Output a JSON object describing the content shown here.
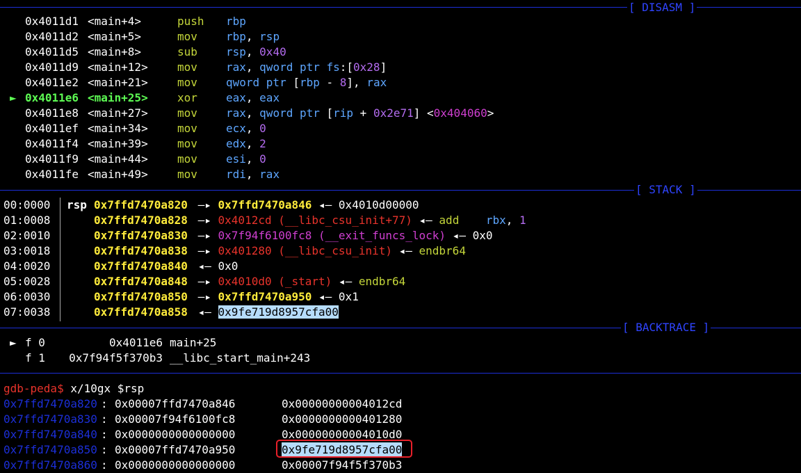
{
  "sections": {
    "disasm": "[ DISASM ]",
    "stack": "[ STACK ]",
    "backtrace": "[ BACKTRACE ]"
  },
  "disasm": [
    {
      "addr": "0x4011d1",
      "sym": "<main+4>",
      "op": "push",
      "args": [
        {
          "t": "rbp",
          "c": "reg"
        }
      ]
    },
    {
      "addr": "0x4011d2",
      "sym": "<main+5>",
      "op": "mov",
      "args": [
        {
          "t": "rbp",
          "c": "reg"
        },
        {
          "t": ", ",
          "c": ""
        },
        {
          "t": "rsp",
          "c": "reg"
        }
      ]
    },
    {
      "addr": "0x4011d5",
      "sym": "<main+8>",
      "op": "sub",
      "args": [
        {
          "t": "rsp",
          "c": "reg"
        },
        {
          "t": ", ",
          "c": ""
        },
        {
          "t": "0x40",
          "c": "num"
        }
      ]
    },
    {
      "addr": "0x4011d9",
      "sym": "<main+12>",
      "op": "mov",
      "args": [
        {
          "t": "rax",
          "c": "reg"
        },
        {
          "t": ", ",
          "c": ""
        },
        {
          "t": "qword ptr ",
          "c": "reg"
        },
        {
          "t": "fs",
          "c": "reg"
        },
        {
          "t": ":[",
          "c": ""
        },
        {
          "t": "0x28",
          "c": "num"
        },
        {
          "t": "]",
          "c": ""
        }
      ]
    },
    {
      "addr": "0x4011e2",
      "sym": "<main+21>",
      "op": "mov",
      "args": [
        {
          "t": "qword ptr ",
          "c": "reg"
        },
        {
          "t": "[",
          "c": ""
        },
        {
          "t": "rbp",
          "c": "reg"
        },
        {
          "t": " - ",
          "c": ""
        },
        {
          "t": "8",
          "c": "num"
        },
        {
          "t": "], ",
          "c": ""
        },
        {
          "t": "rax",
          "c": "reg"
        }
      ]
    },
    {
      "addr": "0x4011e6",
      "sym": "<main+25>",
      "op": "xor",
      "args": [
        {
          "t": "eax",
          "c": "reg"
        },
        {
          "t": ", ",
          "c": ""
        },
        {
          "t": "eax",
          "c": "reg"
        }
      ],
      "current": true
    },
    {
      "addr": "0x4011e8",
      "sym": "<main+27>",
      "op": "mov",
      "args": [
        {
          "t": "rax",
          "c": "reg"
        },
        {
          "t": ", ",
          "c": ""
        },
        {
          "t": "qword ptr ",
          "c": "reg"
        },
        {
          "t": "[",
          "c": ""
        },
        {
          "t": "rip",
          "c": "reg"
        },
        {
          "t": " + ",
          "c": ""
        },
        {
          "t": "0x2e71",
          "c": "num"
        },
        {
          "t": "] <",
          "c": ""
        },
        {
          "t": "0x404060",
          "c": "mag"
        },
        {
          "t": ">",
          "c": ""
        }
      ]
    },
    {
      "addr": "0x4011ef",
      "sym": "<main+34>",
      "op": "mov",
      "args": [
        {
          "t": "ecx",
          "c": "reg"
        },
        {
          "t": ", ",
          "c": ""
        },
        {
          "t": "0",
          "c": "num"
        }
      ]
    },
    {
      "addr": "0x4011f4",
      "sym": "<main+39>",
      "op": "mov",
      "args": [
        {
          "t": "edx",
          "c": "reg"
        },
        {
          "t": ", ",
          "c": ""
        },
        {
          "t": "2",
          "c": "num"
        }
      ]
    },
    {
      "addr": "0x4011f9",
      "sym": "<main+44>",
      "op": "mov",
      "args": [
        {
          "t": "esi",
          "c": "reg"
        },
        {
          "t": ", ",
          "c": ""
        },
        {
          "t": "0",
          "c": "num"
        }
      ]
    },
    {
      "addr": "0x4011fe",
      "sym": "<main+49>",
      "op": "mov",
      "args": [
        {
          "t": "rdi",
          "c": "reg"
        },
        {
          "t": ", ",
          "c": ""
        },
        {
          "t": "rax",
          "c": "reg"
        }
      ]
    }
  ],
  "current_marker": "►",
  "stack": [
    {
      "idx": "00:0000",
      "reg": "rsp",
      "addr": "0x7ffd7470a820",
      "rest": [
        {
          "t": " —▸ ",
          "c": ""
        },
        {
          "t": "0x7ffd7470a846",
          "c": "yel"
        },
        {
          "t": " ◂— 0x4010d00000",
          "c": ""
        }
      ]
    },
    {
      "idx": "01:0008",
      "reg": "",
      "addr": "0x7ffd7470a828",
      "rest": [
        {
          "t": " —▸ ",
          "c": ""
        },
        {
          "t": "0x4012cd (__libc_csu_init+77)",
          "c": "red"
        },
        {
          "t": " ◂— ",
          "c": ""
        },
        {
          "t": "add",
          "c": "mnem"
        },
        {
          "t": "    ",
          "c": ""
        },
        {
          "t": "rbx",
          "c": "reg"
        },
        {
          "t": ", ",
          "c": ""
        },
        {
          "t": "1",
          "c": "num"
        }
      ]
    },
    {
      "idx": "02:0010",
      "reg": "",
      "addr": "0x7ffd7470a830",
      "rest": [
        {
          "t": " —▸ ",
          "c": ""
        },
        {
          "t": "0x7f94f6100fc8 (__exit_funcs_lock)",
          "c": "mag"
        },
        {
          "t": " ◂— 0x0",
          "c": ""
        }
      ]
    },
    {
      "idx": "03:0018",
      "reg": "",
      "addr": "0x7ffd7470a838",
      "rest": [
        {
          "t": " —▸ ",
          "c": ""
        },
        {
          "t": "0x401280 (__libc_csu_init)",
          "c": "red"
        },
        {
          "t": " ◂— ",
          "c": ""
        },
        {
          "t": "endbr64",
          "c": "mnem"
        }
      ]
    },
    {
      "idx": "04:0020",
      "reg": "",
      "addr": "0x7ffd7470a840",
      "rest": [
        {
          "t": " ◂— 0x0",
          "c": ""
        }
      ]
    },
    {
      "idx": "05:0028",
      "reg": "",
      "addr": "0x7ffd7470a848",
      "rest": [
        {
          "t": " —▸ ",
          "c": ""
        },
        {
          "t": "0x4010d0 (_start)",
          "c": "red"
        },
        {
          "t": " ◂— ",
          "c": ""
        },
        {
          "t": "endbr64",
          "c": "mnem"
        }
      ]
    },
    {
      "idx": "06:0030",
      "reg": "",
      "addr": "0x7ffd7470a850",
      "rest": [
        {
          "t": " —▸ ",
          "c": ""
        },
        {
          "t": "0x7ffd7470a950",
          "c": "yel"
        },
        {
          "t": " ◂— 0x1",
          "c": ""
        }
      ]
    },
    {
      "idx": "07:0038",
      "reg": "",
      "addr": "0x7ffd7470a858",
      "rest": [
        {
          "t": " ◂— ",
          "c": ""
        },
        {
          "t": "0x9fe719d8957cfa00",
          "c": "hl"
        }
      ]
    }
  ],
  "backtrace": [
    {
      "marker": "►",
      "frame": "f 0",
      "addr": "0x4011e6",
      "sym": "main+25"
    },
    {
      "marker": "",
      "frame": "f 1",
      "addr": "0x7f94f5f370b3",
      "sym": "__libc_start_main+243"
    }
  ],
  "prompt": "gdb-peda$",
  "command": "x/10gx $rsp",
  "memdump": [
    {
      "addr": "0x7ffd7470a820",
      "v1": "0x00007ffd7470a846",
      "v2": "0x00000000004012cd"
    },
    {
      "addr": "0x7ffd7470a830",
      "v1": "0x00007f94f6100fc8",
      "v2": "0x0000000000401280"
    },
    {
      "addr": "0x7ffd7470a840",
      "v1": "0x0000000000000000",
      "v2": "0x00000000004010d0"
    },
    {
      "addr": "0x7ffd7470a850",
      "v1": "0x00007ffd7470a950",
      "v2": "0x9fe719d8957cfa00",
      "highlight": true
    },
    {
      "addr": "0x7ffd7470a860",
      "v1": "0x0000000000000000",
      "v2": "0x00007f94f5f370b3"
    }
  ],
  "colors": {
    "separator": "#1c2fd8",
    "mnemonic": "#c4d63a",
    "register": "#5ea6ff",
    "number": "#b46cf0",
    "stack_addr": "#ffec3b",
    "code_ptr": "#e8332b",
    "data_ptr": "#cf3fd0",
    "current": "#5dfb53",
    "selection": "#b6dcfb",
    "annotation_box": "#e8202a"
  }
}
